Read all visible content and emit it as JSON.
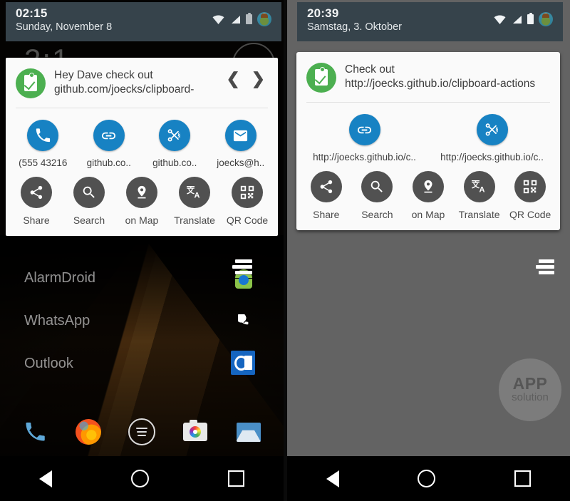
{
  "left": {
    "statusbar": {
      "time": "02:15",
      "date": "Sunday, November 8",
      "icons": [
        "wifi-icon",
        "signal-icon",
        "battery-icon",
        "avatar"
      ]
    },
    "clock_widget": "2:1",
    "card": {
      "app_icon": "clipboard-check-icon",
      "message": "Hey Dave check out github.com/joecks/clipboard-",
      "prev_label": "❮",
      "next_label": "❯",
      "chips": [
        {
          "icon": "phone-icon",
          "label": "(555 43216"
        },
        {
          "icon": "link-icon",
          "label": "github.co.."
        },
        {
          "icon": "scissors-icon",
          "label": "github.co.."
        },
        {
          "icon": "email-icon",
          "label": "joecks@h.."
        }
      ],
      "actions": [
        {
          "icon": "share-icon",
          "label": "Share"
        },
        {
          "icon": "search-icon",
          "label": "Search"
        },
        {
          "icon": "map-pin-icon",
          "label": "on Map"
        },
        {
          "icon": "translate-icon",
          "label": "Translate"
        },
        {
          "icon": "qr-code-icon",
          "label": "QR Code"
        }
      ]
    },
    "apps": [
      {
        "name": "AlarmDroid",
        "icon": "android-icon"
      },
      {
        "name": "WhatsApp",
        "icon": "whatsapp-icon"
      },
      {
        "name": "Outlook",
        "icon": "outlook-icon"
      }
    ],
    "dock": [
      "phone-icon",
      "firefox-icon",
      "app-drawer-icon",
      "camera-icon",
      "inbox-icon"
    ],
    "navbar": [
      "back-icon",
      "home-icon",
      "recents-icon"
    ]
  },
  "right": {
    "statusbar": {
      "time": "20:39",
      "date": "Samstag, 3. Oktober",
      "icons": [
        "wifi-icon",
        "signal-icon",
        "battery-icon",
        "avatar"
      ]
    },
    "card": {
      "app_icon": "clipboard-check-icon",
      "message": "Check out http://joecks.github.io/clipboard-actions",
      "chips": [
        {
          "icon": "link-icon",
          "label": "http://joecks.github.io/c.."
        },
        {
          "icon": "scissors-icon",
          "label": "http://joecks.github.io/c.."
        }
      ],
      "actions": [
        {
          "icon": "share-icon",
          "label": "Share"
        },
        {
          "icon": "search-icon",
          "label": "Search"
        },
        {
          "icon": "map-pin-icon",
          "label": "on Map"
        },
        {
          "icon": "translate-icon",
          "label": "Translate"
        },
        {
          "icon": "qr-code-icon",
          "label": "QR Code"
        }
      ]
    },
    "watermark": {
      "main": "APP",
      "sub": "solution"
    },
    "stack_icon": "stacked-cards-icon",
    "navbar": [
      "back-icon",
      "home-icon",
      "recents-icon"
    ]
  },
  "colors": {
    "status_bar": "#36434b",
    "card_bg": "#fafafa",
    "chip_blue": "#1782c3",
    "action_gray": "#515151",
    "clipboard_green": "#4caf50",
    "right_backdrop": "#636363"
  }
}
